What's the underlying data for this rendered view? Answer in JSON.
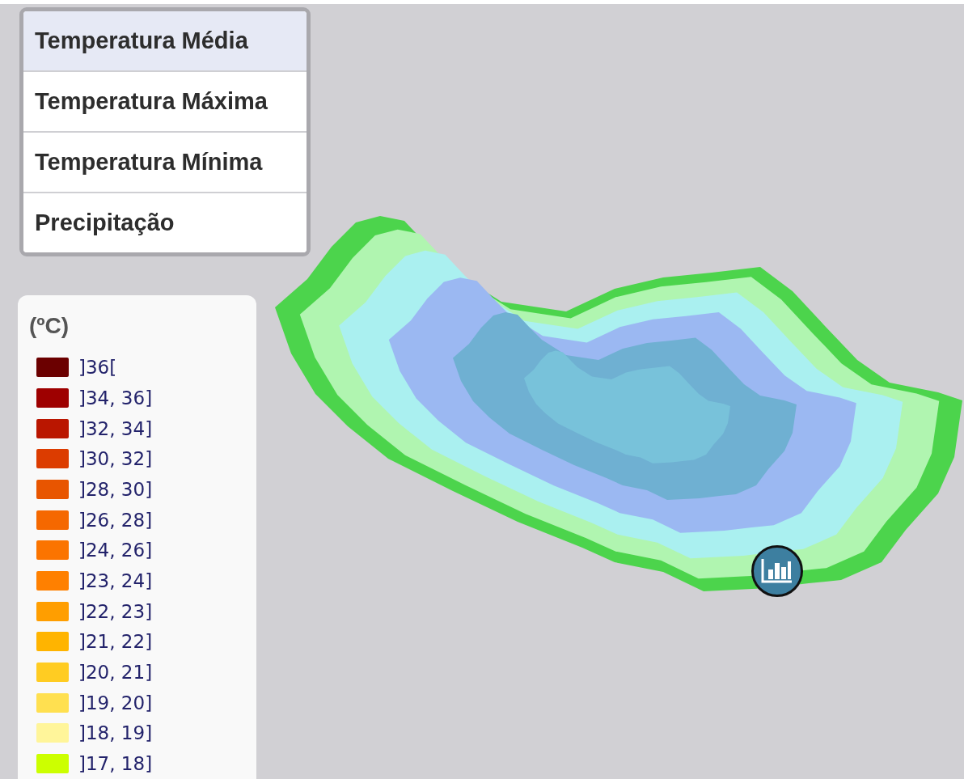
{
  "layer_menu": {
    "items": [
      {
        "label": "Temperatura Média",
        "selected": true
      },
      {
        "label": "Temperatura Máxima",
        "selected": false
      },
      {
        "label": "Temperatura Mínima",
        "selected": false
      },
      {
        "label": "Precipitação",
        "selected": false
      }
    ]
  },
  "legend": {
    "title": "(ºC)",
    "items": [
      {
        "label": "]36[",
        "color": "#6b0000"
      },
      {
        "label": "]34, 36]",
        "color": "#9e0000"
      },
      {
        "label": "]32, 34]",
        "color": "#ba1600"
      },
      {
        "label": "]30, 32]",
        "color": "#dc3c00"
      },
      {
        "label": "]28, 30]",
        "color": "#e85500"
      },
      {
        "label": "]26, 28]",
        "color": "#f56800"
      },
      {
        "label": "]24, 26]",
        "color": "#fb7400"
      },
      {
        "label": "]23, 24]",
        "color": "#ff8000"
      },
      {
        "label": "]22, 23]",
        "color": "#ff9e00"
      },
      {
        "label": "]21, 22]",
        "color": "#ffb400"
      },
      {
        "label": "]20, 21]",
        "color": "#ffcc22"
      },
      {
        "label": "]19, 20]",
        "color": "#ffe050"
      },
      {
        "label": "]18, 19]",
        "color": "#fff59a"
      },
      {
        "label": "]17, 18]",
        "color": "#ccff00"
      }
    ]
  }
}
